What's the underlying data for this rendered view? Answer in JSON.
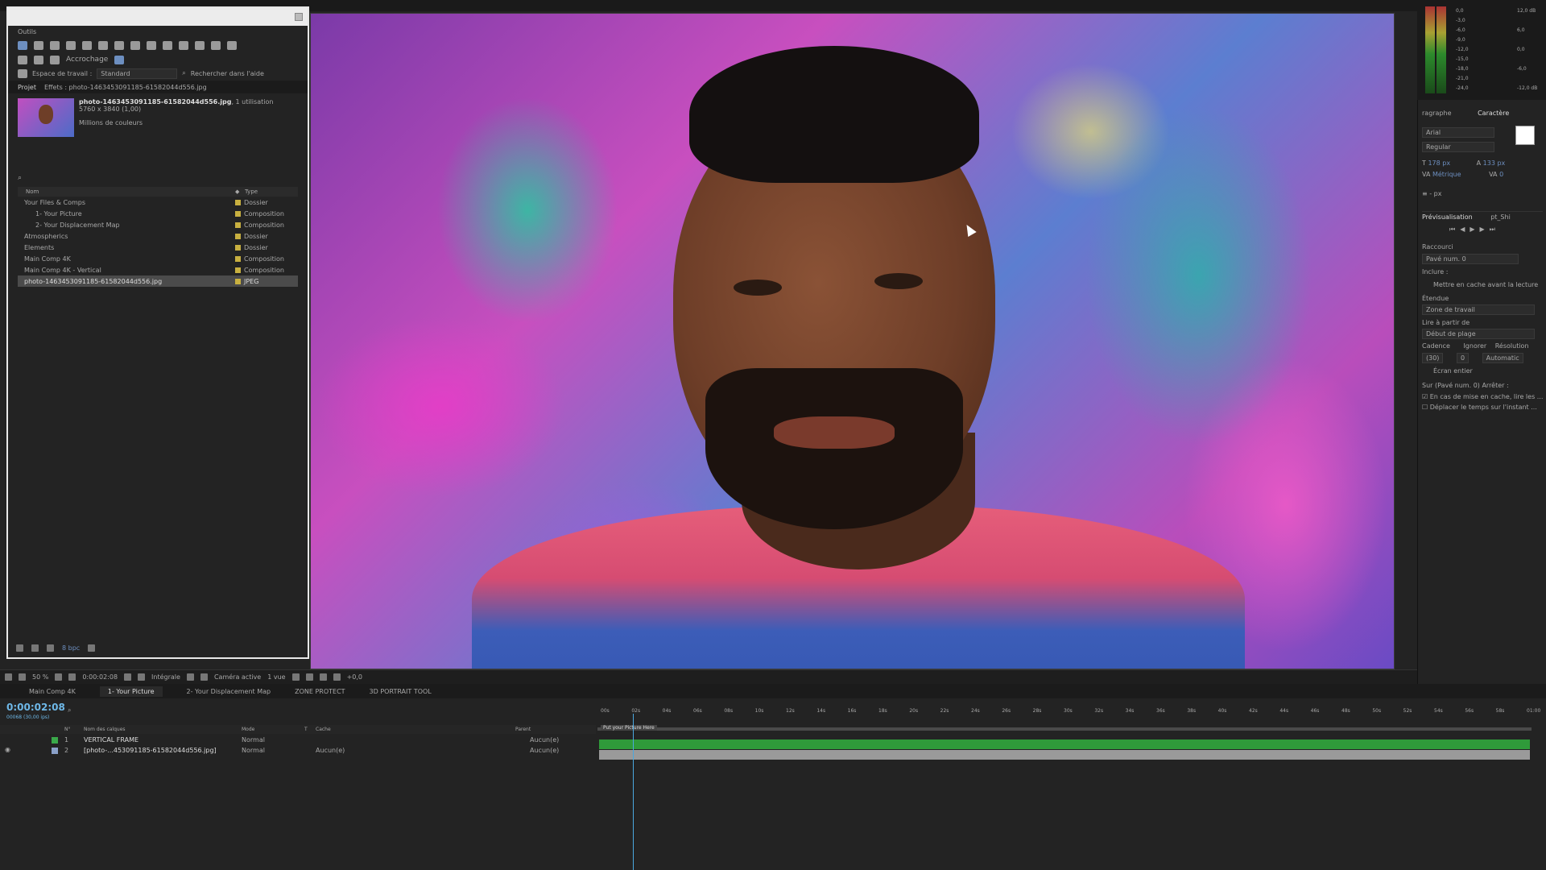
{
  "tools_panel": {
    "title": "Outils",
    "accrochage": "Accrochage"
  },
  "workspace": {
    "label": "Espace de travail :",
    "value": "Standard",
    "search_help": "Rechercher dans l'aide"
  },
  "project": {
    "tab": "Projet",
    "effects_tab": "Effets : photo-1463453091185-61582044d556.jpg",
    "asset_name": "photo-1463453091185-61582044d556.jpg",
    "asset_usage": ", 1 utilisation",
    "asset_dims": "5760 x 3840 (1,00)",
    "asset_colors": "Millions de couleurs",
    "search_placeholder": "",
    "col_name": "Nom",
    "col_type": "Type",
    "items": [
      {
        "name": "Your Files & Comps",
        "type": "Dossier",
        "color": "#c8b040"
      },
      {
        "name": "1- Your Picture",
        "type": "Composition",
        "color": "#c8b040"
      },
      {
        "name": "2- Your Displacement Map",
        "type": "Composition",
        "color": "#c8b040"
      },
      {
        "name": "Atmospherics",
        "type": "Dossier",
        "color": "#c8b040"
      },
      {
        "name": "Elements",
        "type": "Dossier",
        "color": "#c8b040"
      },
      {
        "name": "Main Comp 4K",
        "type": "Composition",
        "color": "#c8b040"
      },
      {
        "name": "Main Comp 4K - Vertical",
        "type": "Composition",
        "color": "#c8b040"
      },
      {
        "name": "photo-1463453091185-61582044d556.jpg",
        "type": "JPEG",
        "color": "#c8b040"
      }
    ],
    "bpc": "8 bpc"
  },
  "viewer_bar": {
    "zoom": "50 %",
    "timecode": "0:00:02:08",
    "resolution": "Intégrale",
    "camera": "Caméra active",
    "views": "1 vue",
    "offset": "+0,0"
  },
  "meters": {
    "levels": [
      "0,0",
      "-3,0",
      "-6,0",
      "-9,0",
      "-12,0",
      "-15,0",
      "-18,0",
      "-21,0",
      "-24,0"
    ],
    "right": [
      "12,0 dB",
      "6,0",
      "0,0",
      "-6,0",
      "-12,0 dB"
    ]
  },
  "character": {
    "tab_left": "ragraphe",
    "tab": "Caractère",
    "font": "Arial",
    "style": "Regular",
    "size": "178 px",
    "leading": "133 px",
    "kerning": "Métrique",
    "tracking": "0",
    "unit": "- px"
  },
  "preview": {
    "tab": "Prévisualisation",
    "tab2": "pt_Shi",
    "shortcut_label": "Raccourci",
    "shortcut": "Pavé num. 0",
    "include": "Inclure :",
    "cache_before": "Mettre en cache avant la lecture",
    "range_label": "Étendue",
    "range": "Zone de travail",
    "play_from_label": "Lire à partir de",
    "play_from": "Début de plage",
    "frame_rate_label": "Cadence",
    "skip_label": "Ignorer",
    "res_label": "Résolution",
    "frame_rate": "(30)",
    "skip": "0",
    "res": "Automatic",
    "full_screen": "Écran entier",
    "stop_label": "Sur (Pavé num. 0) Arrêter :",
    "opt1": "En cas de mise en cache, lire les ...",
    "opt2": "Déplacer le temps sur l'instant ..."
  },
  "timeline": {
    "tabs": [
      "Main Comp 4K",
      "1- Your Picture",
      "2- Your Displacement Map",
      "ZONE PROTECT",
      "3D PORTRAIT TOOL"
    ],
    "time": "0:00:02:08",
    "fps": "00068 (30,00 ips)",
    "cols": {
      "num": "N°",
      "name": "Nom des calques",
      "mode": "Mode",
      "t": "T",
      "cache": "Cache",
      "parent": "Parent"
    },
    "layers": [
      {
        "num": "1",
        "name": "VERTICAL FRAME",
        "mode": "Normal",
        "cache": "",
        "parent": "Aucun(e)"
      },
      {
        "num": "2",
        "name": "[photo-...453091185-61582044d556.jpg]",
        "mode": "Normal",
        "cache": "Aucun(e)",
        "parent": "Aucun(e)"
      }
    ],
    "marker": "Put your Picture Here",
    "ruler": [
      "00s",
      "02s",
      "04s",
      "06s",
      "08s",
      "10s",
      "12s",
      "14s",
      "16s",
      "18s",
      "20s",
      "22s",
      "24s",
      "26s",
      "28s",
      "30s",
      "32s",
      "34s",
      "36s",
      "38s",
      "40s",
      "42s",
      "44s",
      "46s",
      "48s",
      "50s",
      "52s",
      "54s",
      "56s",
      "58s",
      "01:00"
    ]
  }
}
